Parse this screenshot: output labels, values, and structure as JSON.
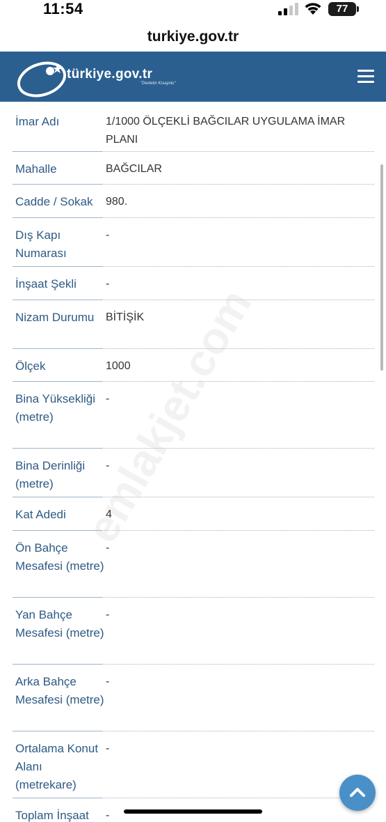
{
  "status_bar": {
    "time": "11:54",
    "battery": "77"
  },
  "browser": {
    "url": "turkiye.gov.tr"
  },
  "header": {
    "logo_text": "türkiye.gov.tr",
    "logo_subtext": "\"Devletin Kısayolu\"",
    "menu_icon": "hamburger-menu-icon",
    "brand_color": "#2b5f8f"
  },
  "rows": [
    {
      "label": "İmar Adı",
      "value": "1/1000 ÖLÇEKLİ BAĞCILAR UYGULAMA İMAR PLANI"
    },
    {
      "label": "Mahalle",
      "value": "BAĞCILAR"
    },
    {
      "label": "Cadde / Sokak",
      "value": "980."
    },
    {
      "label": "Dış Kapı Numarası",
      "value": "-"
    },
    {
      "label": "İnşaat Şekli",
      "value": "-"
    },
    {
      "label": "Nizam Durumu",
      "value": "BİTİŞİK"
    },
    {
      "label": "Ölçek",
      "value": "1000"
    },
    {
      "label": "Bina Yüksekliği (metre)",
      "value": "-"
    },
    {
      "label": "Bina Derinliği (metre)",
      "value": "-"
    },
    {
      "label": "Kat Adedi",
      "value": "4"
    },
    {
      "label": "Ön Bahçe Mesafesi (metre)",
      "value": "-"
    },
    {
      "label": "Yan Bahçe Mesafesi (metre)",
      "value": "-"
    },
    {
      "label": "Arka Bahçe Mesafesi (metre)",
      "value": "-"
    },
    {
      "label": "Ortalama Konut Alanı (metrekare)",
      "value": "-"
    },
    {
      "label": "Toplam İnşaat",
      "value": "-"
    }
  ],
  "watermark": "emlakjet.com",
  "scroll_top_icon": "chevron-up-icon"
}
